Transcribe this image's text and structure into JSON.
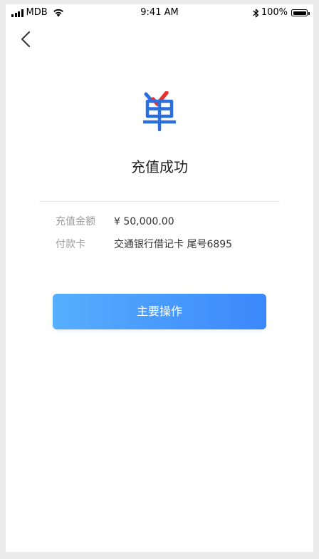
{
  "status_bar": {
    "carrier": "MDB",
    "time": "9:41 AM",
    "battery": "100%"
  },
  "page": {
    "title": "充值成功"
  },
  "details": [
    {
      "label": "充值金额",
      "value": "¥ 50,000.00"
    },
    {
      "label": "付款卡",
      "value": "交通银行借记卡  尾号6895"
    }
  ],
  "primary_action": {
    "label": "主要操作"
  },
  "colors": {
    "accent_blue": "#3b88fb",
    "accent_blue_light": "#57aefc",
    "check_red": "#e5342f",
    "logo_blue": "#2a6fdb"
  },
  "icons": {
    "back": "chevron-left-icon",
    "logo": "bill-success-icon"
  }
}
